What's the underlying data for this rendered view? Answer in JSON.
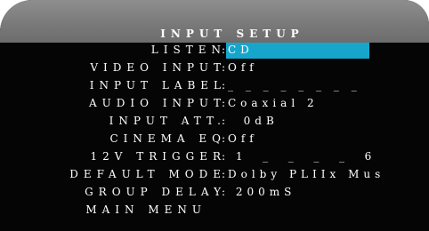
{
  "title": "INPUT SETUP",
  "menu": [
    {
      "label": "LISTEN",
      "value": "CD"
    },
    {
      "label": "VIDEO INPUT",
      "value": "Off"
    },
    {
      "label": "INPUT LABEL",
      "value": "_ _ _ _ _ _ _ _"
    },
    {
      "label": "AUDIO INPUT",
      "value": "Coaxial 2"
    },
    {
      "label": "INPUT ATT.",
      "value": "  0dB"
    },
    {
      "label": "CINEMA EQ",
      "value": "Off"
    },
    {
      "label": "12V TRIGGER",
      "value": " 1  _  _  _  _  6"
    },
    {
      "label": "DEFAULT MODE",
      "value": "Dolby PLIIx Mus"
    },
    {
      "label": "GROUP DELAY",
      "value": " 200mS"
    },
    {
      "label": "MAIN MENU",
      "value": ""
    }
  ],
  "colors": {
    "background": "#050505",
    "header": "#7a7a7a",
    "highlight": "#16a6cc",
    "text": "#ffffff"
  }
}
